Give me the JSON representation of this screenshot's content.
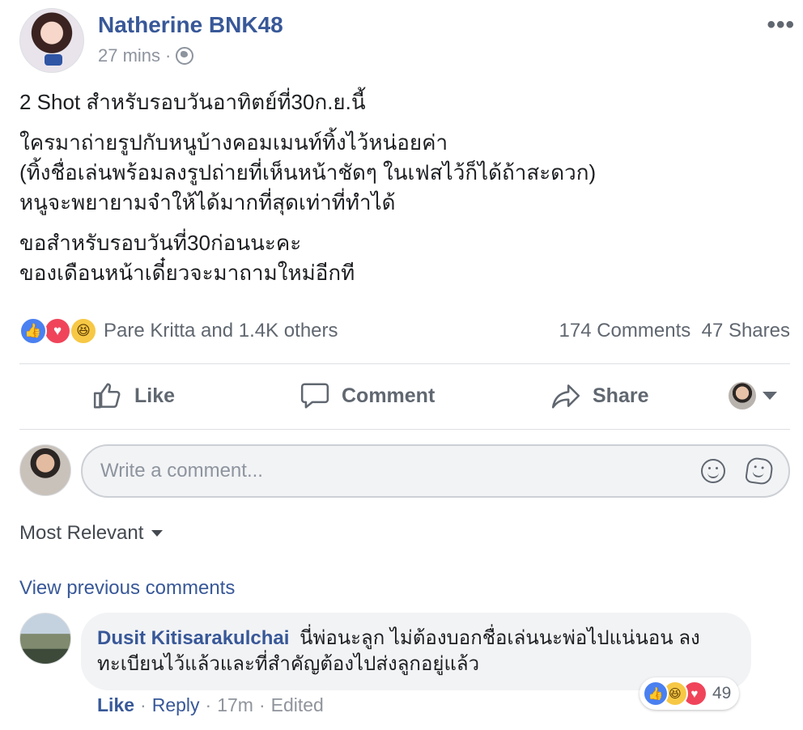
{
  "post": {
    "author": "Natherine BNK48",
    "time": "27 mins",
    "separator": "·",
    "more": "•••",
    "paragraphs": [
      [
        "2 Shot สำหรับรอบวันอาทิตย์ที่30ก.ย.นี้"
      ],
      [
        "ใครมาถ่ายรูปกับหนูบ้างคอมเมนท์ทิ้งไว้หน่อยค่า",
        "(ทิ้งชื่อเล่นพร้อมลงรูปถ่ายที่เห็นหน้าชัดๆ ในเฟสไว้ก็ได้ถ้าสะดวก)",
        "หนูจะพยายามจำให้ได้มากที่สุดเท่าที่ทำได้"
      ],
      [
        "ขอสำหรับรอบวันที่30ก่อนนะคะ",
        "ของเดือนหน้าเดี๋ยวจะมาถามใหม่อีกที"
      ]
    ]
  },
  "reactions": {
    "names": "Pare Kritta and 1.4K others",
    "counts": "174 Comments  47 Shares"
  },
  "actions": {
    "like": "Like",
    "comment": "Comment",
    "share": "Share"
  },
  "composer": {
    "placeholder": "Write a comment..."
  },
  "sort": {
    "label": "Most Relevant"
  },
  "comments": {
    "view_previous": "View previous comments",
    "items": [
      {
        "author": "Dusit Kitisarakulchai",
        "text": "นี่พ่อนะลูก ไม่ต้องบอกชื่อเล่นนะพ่อไปแน่นอน ลงทะเบียนไว้แล้วและที่สำคัญต้องไปส่งลูกอยู่แล้ว",
        "reaction_count": "49",
        "like": "Like",
        "reply": "Reply",
        "time": "17m",
        "edited": "Edited",
        "dot": "·"
      }
    ]
  },
  "colors": {
    "link": "#385898",
    "muted": "#606770",
    "like": "#4a80f0",
    "love": "#f0445a",
    "haha": "#f7c845"
  },
  "icons": {
    "like_reaction": "👍",
    "love_reaction": "♥",
    "haha_reaction": "😆"
  }
}
